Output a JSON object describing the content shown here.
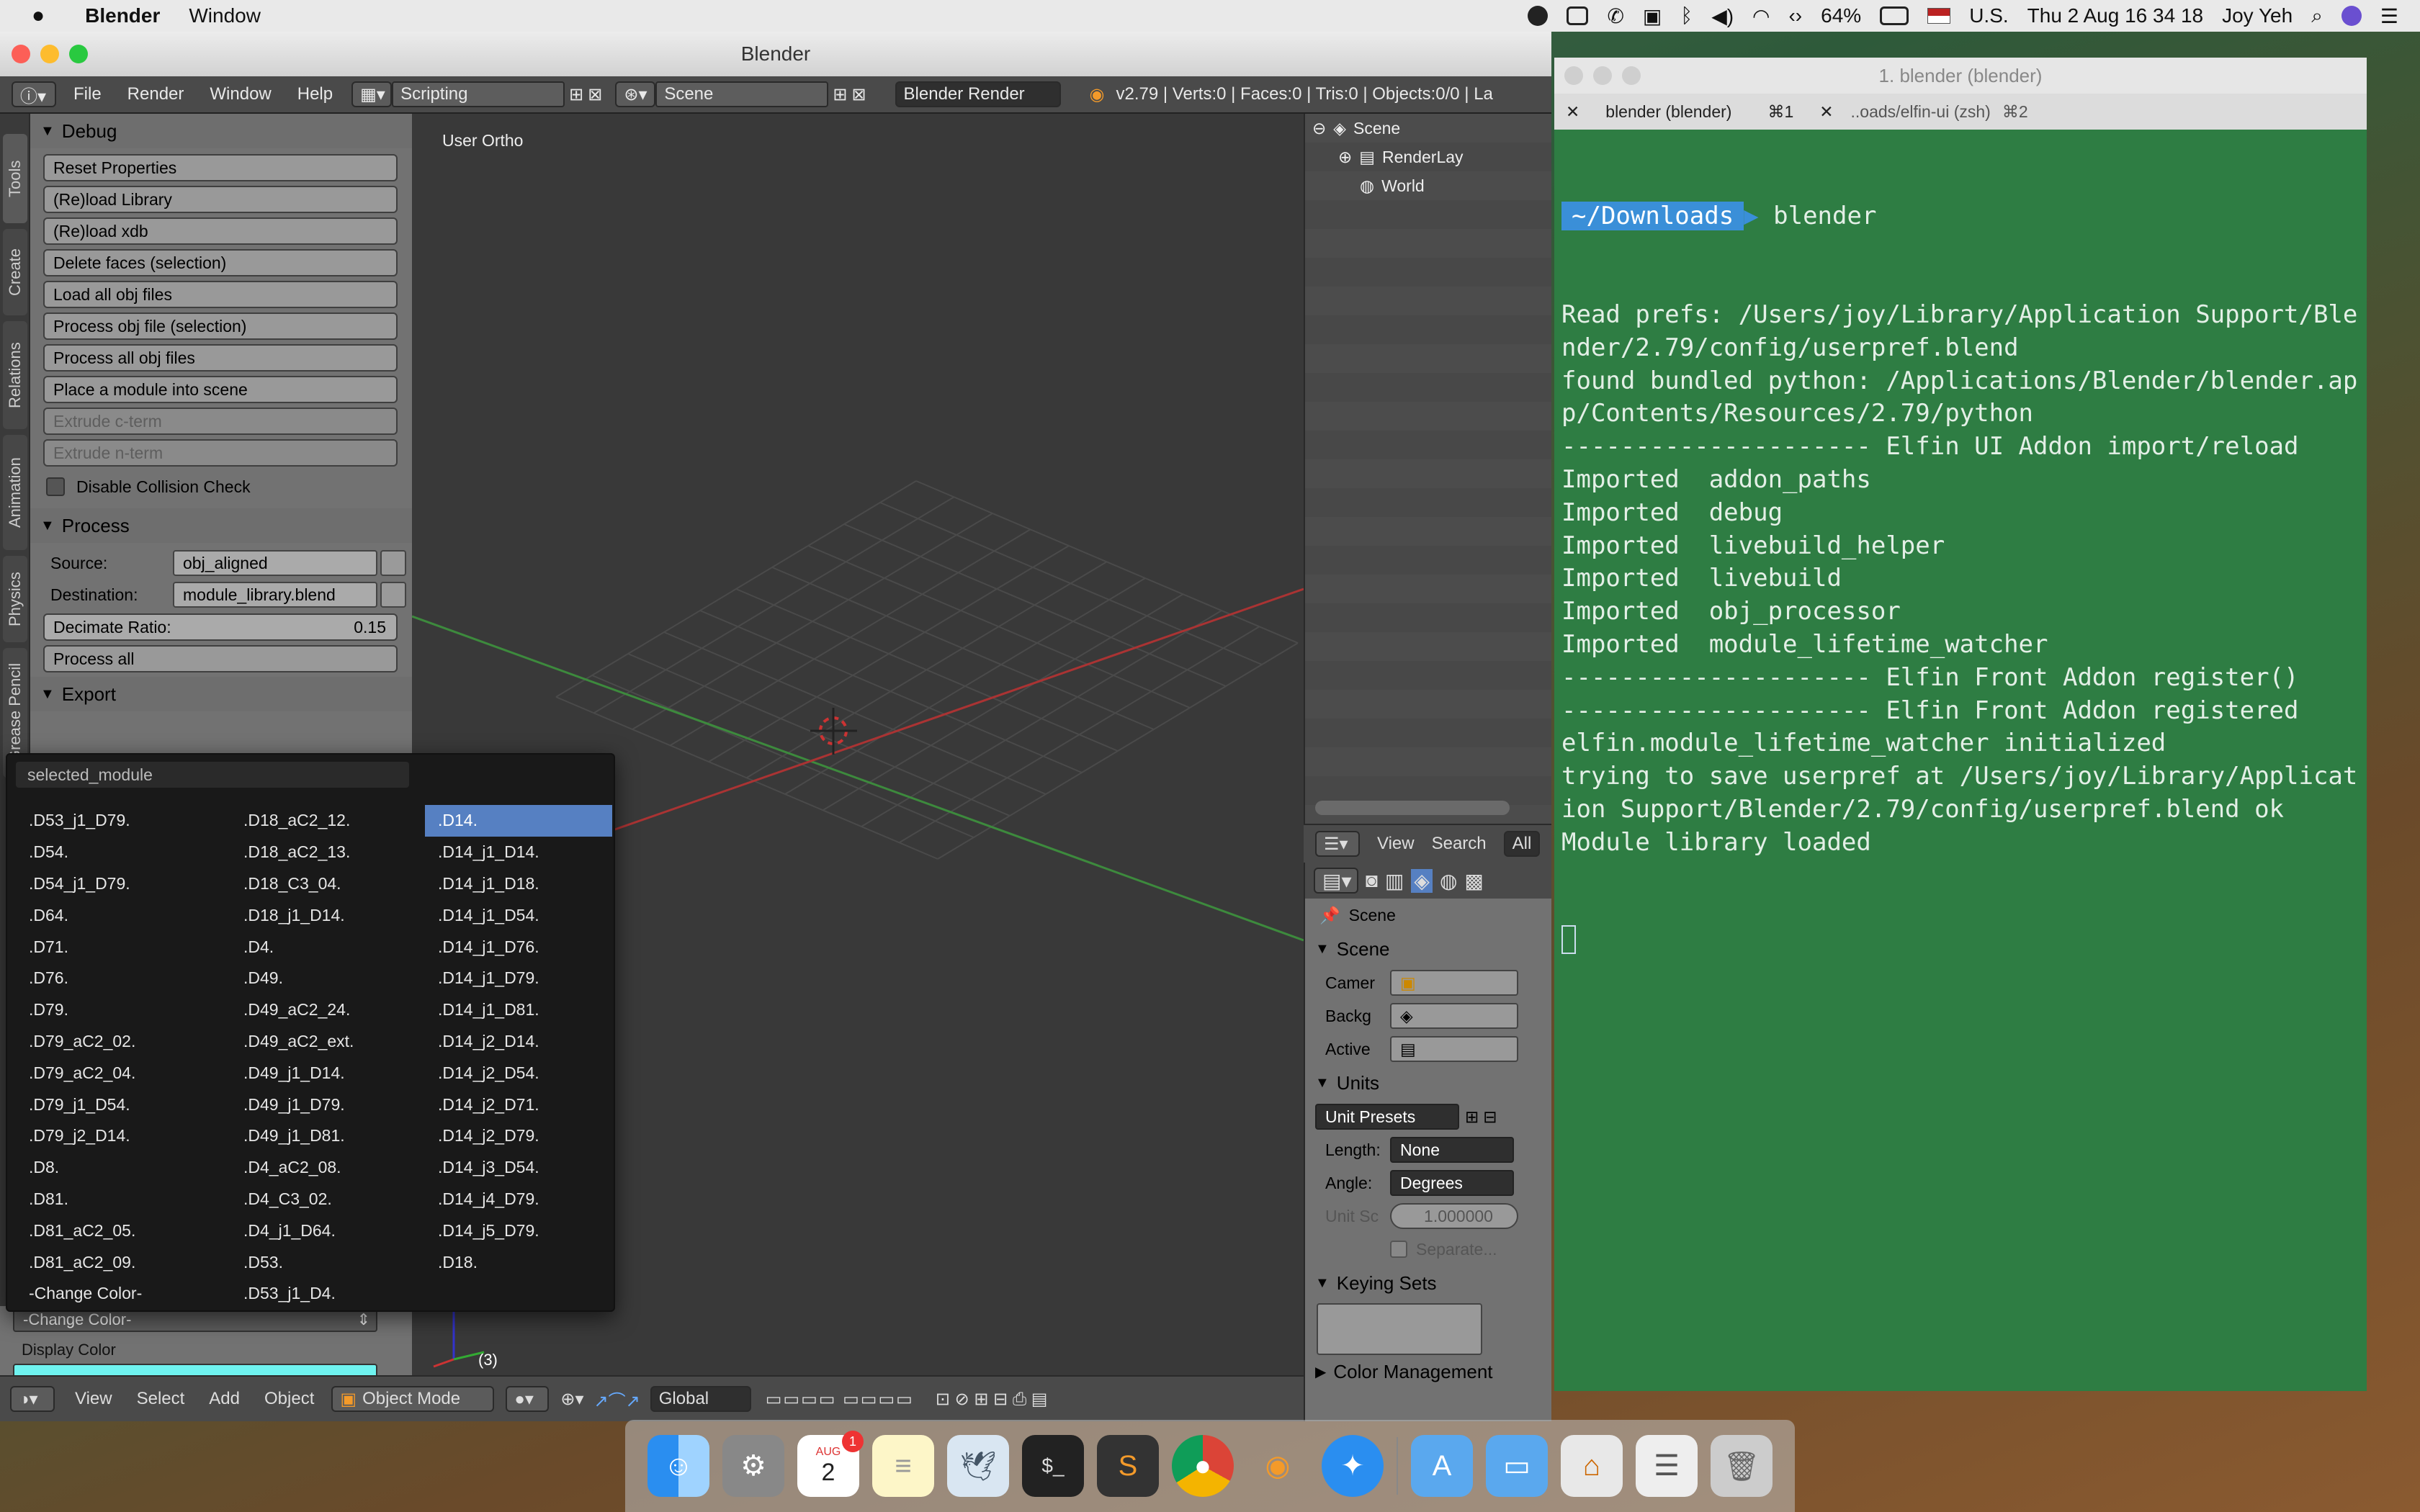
{
  "menubar": {
    "app_name": "Blender",
    "menu_window": "Window",
    "battery_pct": "64%",
    "input_source": "U.S.",
    "clock": "Thu 2 Aug  16 34 18",
    "user": "Joy Yeh"
  },
  "blender": {
    "title": "Blender",
    "info": {
      "menus": [
        "File",
        "Render",
        "Window",
        "Help"
      ],
      "layout": "Scripting",
      "scene": "Scene",
      "engine": "Blender Render",
      "stats": "v2.79 | Verts:0 | Faces:0 | Tris:0 | Objects:0/0 | La"
    },
    "tabs": [
      "Tools",
      "Create",
      "Relations",
      "Animation",
      "Physics",
      "Grease Pencil"
    ],
    "debug": {
      "title": "Debug",
      "buttons": [
        "Reset Properties",
        "(Re)load Library",
        "(Re)load xdb",
        "Delete faces (selection)",
        "Load all obj files",
        "Process obj file (selection)",
        "Process all obj files",
        "Place a module into scene"
      ],
      "disabled_buttons": [
        "Extrude c-term",
        "Extrude n-term"
      ],
      "checkbox": "Disable Collision Check"
    },
    "process": {
      "title": "Process",
      "source_label": "Source:",
      "source_value": "obj_aligned",
      "dest_label": "Destination:",
      "dest_value": "module_library.blend",
      "decimate_label": "Decimate Ratio:",
      "decimate_value": "0.15",
      "process_all": "Process all"
    },
    "export": {
      "title": "Export"
    },
    "dropdown": {
      "search": "selected_module",
      "col1": [
        ".D53_j1_D79.",
        ".D54.",
        ".D54_j1_D79.",
        ".D64.",
        ".D71.",
        ".D76.",
        ".D79.",
        ".D79_aC2_02.",
        ".D79_aC2_04.",
        ".D79_j1_D54.",
        ".D79_j2_D14.",
        ".D8.",
        ".D81.",
        ".D81_aC2_05.",
        ".D81_aC2_09.",
        "-Change Color-"
      ],
      "col2": [
        ".D18_aC2_12.",
        ".D18_aC2_13.",
        ".D18_C3_04.",
        ".D18_j1_D14.",
        ".D4.",
        ".D49.",
        ".D49_aC2_24.",
        ".D49_aC2_ext.",
        ".D49_j1_D14.",
        ".D49_j1_D79.",
        ".D49_j1_D81.",
        ".D4_aC2_08.",
        ".D4_C3_02.",
        ".D4_j1_D64.",
        ".D53.",
        ".D53_j1_D4."
      ],
      "col3": [
        ".D14.",
        ".D14_j1_D14.",
        ".D14_j1_D18.",
        ".D14_j1_D54.",
        ".D14_j1_D76.",
        ".D14_j1_D79.",
        ".D14_j1_D81.",
        ".D14_j2_D14.",
        ".D14_j2_D54.",
        ".D14_j2_D71.",
        ".D14_j2_D79.",
        ".D14_j3_D54.",
        ".D14_j4_D79.",
        ".D14_j5_D79.",
        ".D18."
      ],
      "selected": ".D14."
    },
    "color_select": "-Change Color-",
    "display_color_label": "Display Color",
    "display_color": "#6ff3f0",
    "viewport": {
      "label": "User Ortho",
      "frame": "(3)",
      "menus": [
        "View",
        "Select",
        "Add",
        "Object"
      ],
      "mode": "Object Mode",
      "orientation": "Global"
    },
    "outliner": {
      "items": [
        "Scene",
        "RenderLay",
        "World"
      ],
      "bar": [
        "View",
        "Search",
        "All"
      ]
    },
    "properties": {
      "context": "Scene",
      "scene_title": "Scene",
      "camera_label": "Camer",
      "background_label": "Backg",
      "active_label": "Active",
      "units_title": "Units",
      "unit_presets": "Unit Presets",
      "length_label": "Length:",
      "length_value": "None",
      "angle_label": "Angle:",
      "angle_value": "Degrees",
      "unit_scale_label": "Unit Sc",
      "unit_scale_value": "1.000000",
      "separate_label": "Separate...",
      "keying_title": "Keying Sets",
      "color_mgmt": "Color Management"
    }
  },
  "terminal": {
    "title": "1. blender (blender)",
    "tab1": "blender (blender)",
    "tab1_key": "⌘1",
    "tab2": "..oads/elfin-ui (zsh)",
    "tab2_key": "⌘2",
    "prompt_dir": "~/Downloads",
    "command": "blender",
    "output": "Read prefs: /Users/joy/Library/Application Support/Blender/2.79/config/userpref.blend\nfound bundled python: /Applications/Blender/blender.app/Contents/Resources/2.79/python\n--------------------- Elfin UI Addon import/reload\nImported  addon_paths\nImported  debug\nImported  livebuild_helper\nImported  livebuild\nImported  obj_processor\nImported  module_lifetime_watcher\n--------------------- Elfin Front Addon register()\n--------------------- Elfin Front Addon registered\nelfin.module_lifetime_watcher initialized\ntrying to save userpref at /Users/joy/Library/Application Support/Blender/2.79/config/userpref.blend ok\nModule library loaded"
  },
  "dock": {
    "calendar_month": "AUG",
    "calendar_day": "2",
    "calendar_badge": "1"
  }
}
